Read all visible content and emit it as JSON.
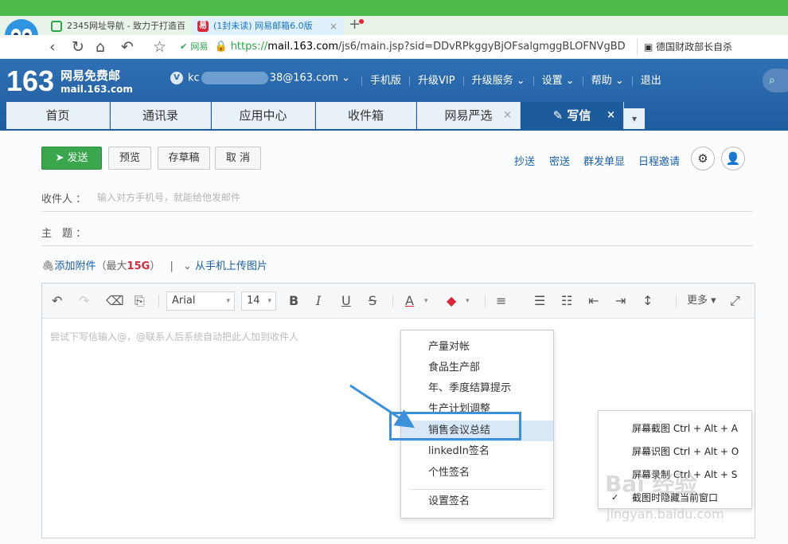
{
  "browser": {
    "tabs": [
      {
        "label": "2345网址导航 - 致力于打造百",
        "close": ""
      },
      {
        "label": "(1封未读) 网易邮箱6.0版",
        "close": "×",
        "icon_letter": "易"
      }
    ],
    "new_tab": "+",
    "nav": {
      "back": "‹",
      "reload": "↻",
      "home": "⌂",
      "undo": "↶",
      "star": "☆"
    },
    "address": {
      "secure_label": "网易",
      "scheme": "https://",
      "host": "mail.163.com",
      "path": "/js6/main.jsp?sid=DDvRPkggyBjOFsalgmggBLOFNVgBD"
    },
    "news_text": "德国财政部长自杀"
  },
  "mail_header": {
    "logo_number": "163",
    "logo_title": "网易免费邮",
    "logo_domain": "mail.163.com",
    "user_prefix": "kc",
    "user_suffix": "38@163.com",
    "user_badge": "V",
    "links": [
      "手机版",
      "升级VIP",
      "升级服务",
      "设置",
      "帮助",
      "退出"
    ]
  },
  "nav_tabs": [
    {
      "label": "首页"
    },
    {
      "label": "通讯录"
    },
    {
      "label": "应用中心"
    },
    {
      "label": "收件箱"
    },
    {
      "label": "网易严选",
      "close": "×"
    },
    {
      "label": "写信",
      "close": "×",
      "icon": "✎"
    }
  ],
  "compose": {
    "buttons": {
      "send": "发送",
      "preview": "预览",
      "draft": "存草稿",
      "cancel": "取 消"
    },
    "right_links": [
      "抄送",
      "密送",
      "群发单显",
      "日程邀请"
    ],
    "to_label": "收件人 ：",
    "to_placeholder": "输入对方手机号，就能给他发邮件",
    "subject_label": "主　题 ：",
    "attach_label": "添加附件",
    "attach_limit_prefix": "（最大",
    "attach_limit": "15G",
    "attach_limit_suffix": "）",
    "phone_upload": "从手机上传图片",
    "toolbar": {
      "font": "Arial",
      "size": "14",
      "more": "更多"
    },
    "editor_placeholder": "尝试下写信输入@，@联系人后系统自动把此人加到收件人"
  },
  "signature_menu": {
    "items": [
      "产量对帐",
      "食品生产部",
      "年、季度结算提示",
      "生产计划调整",
      "销售会议总结",
      "linkedIn签名",
      "个性签名",
      "设置签名"
    ],
    "highlighted_index": 4
  },
  "context_menu": {
    "items": [
      {
        "label": "屏幕截图 Ctrl + Alt + A",
        "checked": ""
      },
      {
        "label": "屏幕识图 Ctrl + Alt + O",
        "checked": ""
      },
      {
        "label": "屏幕录制 Ctrl + Alt + S",
        "checked": ""
      },
      {
        "label": "截图时隐藏当前窗口",
        "checked": "✓"
      }
    ]
  },
  "watermark": {
    "line1": "Bai 经验",
    "line2": "jingyan.baidu.com"
  },
  "colors": {
    "accent": "#1d5c9c",
    "send": "#3aa74d",
    "highlight": "#3b92da",
    "browser_green": "#4cbb4a"
  }
}
